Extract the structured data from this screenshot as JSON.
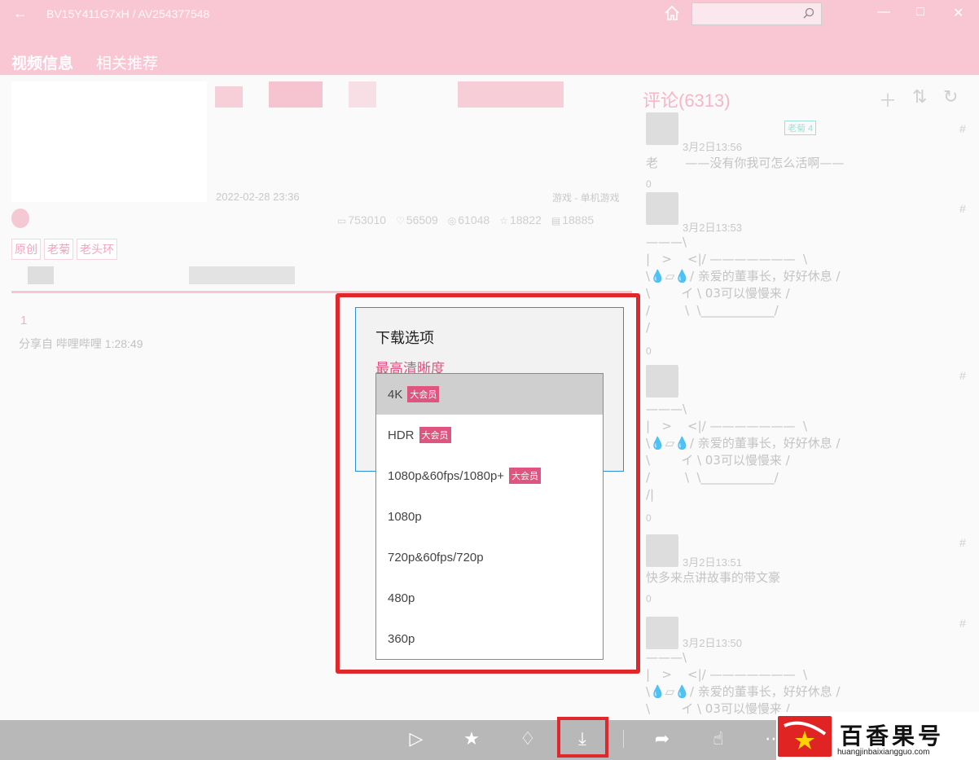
{
  "window": {
    "title": "BV15Y411G7xH / AV254377548",
    "search_placeholder": ""
  },
  "header": {
    "tabs": [
      {
        "label": "视频信息",
        "active": true
      },
      {
        "label": "相关推荐",
        "active": false
      }
    ]
  },
  "video": {
    "date": "2022-02-28 23:36",
    "category": "游戏 - 单机游戏",
    "stats": {
      "plays": "753010",
      "likes": "56509",
      "coins": "61048",
      "favorites": "18822",
      "danmaku": "18885"
    },
    "tags": [
      "原创",
      "老菊",
      "老头环"
    ],
    "reply_number": "1",
    "share_text": "分享自 哔哩哔哩 1:28:49"
  },
  "comments": {
    "title": "评论(6313)",
    "items": [
      {
        "level": "老菊 4",
        "time": "3月2日13:56",
        "text": "老       ——没有你我可怎么活啊——",
        "count": "0"
      },
      {
        "time": "3月2日13:53",
        "text": "———\\\n|   >    <|/ ———————  \\\n\\💧▱💧/ 亲爱的董事长，好好休息 /\n\\        イ \\ 03可以慢慢来 /\n/         \\  \\____________/\n/",
        "count": "0"
      },
      {
        "time": "",
        "text": "———\\\n|   >    <|/ ———————  \\\n\\💧▱💧/ 亲爱的董事长，好好休息 /\n\\        イ \\ 03可以慢慢来 /\n/         \\  \\____________/\n/|",
        "count": "0"
      },
      {
        "time": "3月2日13:51",
        "text": "快多来点讲故事的带文豪",
        "count": "0"
      },
      {
        "time": "3月2日13:50",
        "text": "———\\\n|   >    <|/ ———————  \\\n\\💧▱💧/ 亲爱的董事长，好好休息 /\n\\        イ \\ 03可以慢慢来 /",
        "count": ""
      }
    ]
  },
  "dialog": {
    "title": "下载选项",
    "quality_label": "最高清晰度",
    "options": [
      {
        "label": "4K",
        "badge": "大会员"
      },
      {
        "label": "HDR",
        "badge": "大会员"
      },
      {
        "label": "1080p&60fps/1080p+",
        "badge": "大会员"
      },
      {
        "label": "1080p",
        "badge": ""
      },
      {
        "label": "720p&60fps/720p",
        "badge": ""
      },
      {
        "label": "480p",
        "badge": ""
      },
      {
        "label": "360p",
        "badge": ""
      }
    ],
    "selected_index": 0
  },
  "watermark": {
    "name": "百香果号",
    "url": "huangjinbaixiangguo.com"
  },
  "colors": {
    "header_pink": "#f9c7d4",
    "accent_pink": "#e0557f",
    "highlight_red": "#e0282c"
  }
}
